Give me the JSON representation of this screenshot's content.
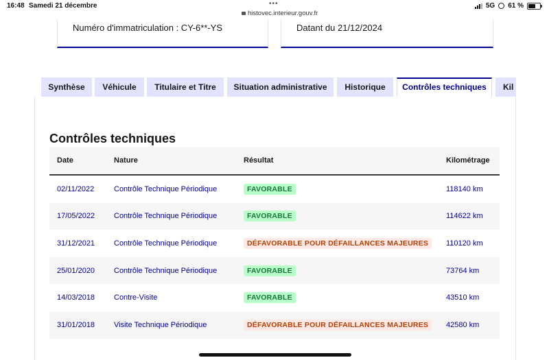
{
  "status_bar": {
    "time": "16:48",
    "date": "Samedi 21 décembre",
    "url": "histovec.interieur.gouv.fr",
    "network": "5G",
    "battery": "61 %",
    "battery_level": 0.61
  },
  "vehicle_cards": {
    "registration": "Numéro d'immatriculation : CY-6**-YS",
    "dated": "Datant du 21/12/2024"
  },
  "tabs": [
    {
      "label": "Synthèse",
      "active": false
    },
    {
      "label": "Véhicule",
      "active": false
    },
    {
      "label": "Titulaire et Titre",
      "active": false
    },
    {
      "label": "Situation administrative",
      "active": false
    },
    {
      "label": "Historique",
      "active": false
    },
    {
      "label": "Contrôles techniques",
      "active": true
    },
    {
      "label": "Kil",
      "active": false
    }
  ],
  "section": {
    "title": "Contrôles techniques"
  },
  "table": {
    "headers": {
      "date": "Date",
      "nature": "Nature",
      "result": "Résultat",
      "mileage": "Kilométrage"
    },
    "rows": [
      {
        "date": "02/11/2022",
        "nature": "Contrôle Technique Périodique",
        "result": "FAVORABLE",
        "status": "ok",
        "mileage": "118140 km"
      },
      {
        "date": "17/05/2022",
        "nature": "Contrôle Technique Périodique",
        "result": "FAVORABLE",
        "status": "ok",
        "mileage": "114622 km"
      },
      {
        "date": "31/12/2021",
        "nature": "Contrôle Technique Périodique",
        "result": "DÉFAVORABLE POUR DÉFAILLANCES MAJEURES",
        "status": "bad",
        "mileage": "110120 km"
      },
      {
        "date": "25/01/2020",
        "nature": "Contrôle Technique Périodique",
        "result": "FAVORABLE",
        "status": "ok",
        "mileage": "73764 km"
      },
      {
        "date": "14/03/2018",
        "nature": "Contre-Visite",
        "result": "FAVORABLE",
        "status": "ok",
        "mileage": "43510 km"
      },
      {
        "date": "31/01/2018",
        "nature": "Visite Technique Périodique",
        "result": "DÉFAVORABLE POUR DÉFAILLANCES MAJEURES",
        "status": "bad",
        "mileage": "42580 km"
      }
    ]
  },
  "colors": {
    "primary": "#000091",
    "tab_bg": "#e3e3fd",
    "success_bg": "#b8fec9",
    "success_text": "#18753c",
    "error_bg": "#ffe9e6",
    "error_text": "#b34000"
  }
}
